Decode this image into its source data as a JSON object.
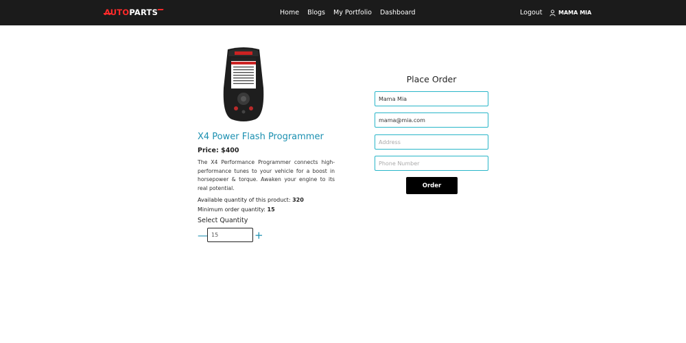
{
  "brand": {
    "part1": "AUTO",
    "part2": "PARTS"
  },
  "nav": {
    "links": [
      "Home",
      "Blogs",
      "My Portfolio",
      "Dashboard"
    ],
    "logout": "Logout",
    "user_name": "MAMA MIA"
  },
  "product": {
    "title": "X4 Power Flash Programmer",
    "price": "Price: $400",
    "description": "The X4 Performance Programmer connects high-performance tunes to your vehicle for a boost in horsepower & torque. Awaken your engine to its real potential.",
    "available_label": "Available quantity of this product: ",
    "available_value": "320",
    "min_label": "Minimum order quantity: ",
    "min_value": "15",
    "select_quantity_label": "Select Quantity",
    "quantity_value": "15",
    "minus_symbol": "—",
    "plus_symbol": "+"
  },
  "order": {
    "title": "Place Order",
    "name_value": "Mama Mia",
    "email_value": "mama@mia.com",
    "address_placeholder": "Address",
    "phone_placeholder": "Phone Number",
    "button_label": "Order"
  },
  "colors": {
    "navbar_bg": "#1b1b1b",
    "brand_red": "#ff2a2a",
    "accent": "#1a8fb0",
    "input_border": "#27b5c8"
  },
  "icons": {
    "user": "user-outline-icon",
    "product": "obd-programmer-device-image"
  }
}
